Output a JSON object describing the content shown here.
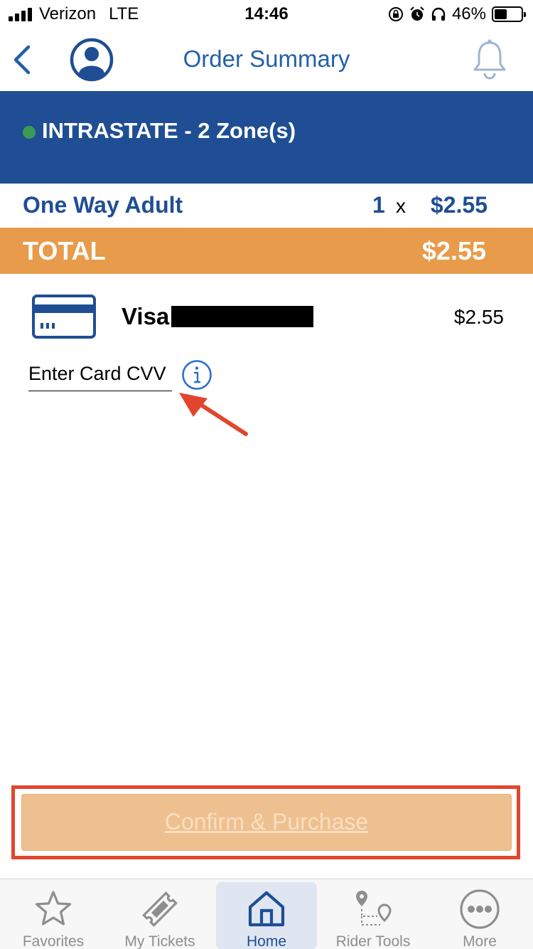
{
  "status_bar": {
    "carrier": "Verizon",
    "network": "LTE",
    "time": "14:46",
    "battery": "46%",
    "battery_level": 0.46
  },
  "nav": {
    "title": "Order Summary",
    "icons": [
      "back-chevron-icon",
      "user-avatar-icon",
      "bell-icon"
    ]
  },
  "colors": {
    "brand_blue": "#1f4e94",
    "link_blue": "#2460a7",
    "total_orange": "#e89b4a",
    "confirm_disabled": "#efc08f",
    "annotation_red": "#e2452f",
    "zone_dot_green": "#3e9a57"
  },
  "zone": {
    "title": "INTRASTATE - 2 Zone(s)"
  },
  "line_item": {
    "name": "One Way Adult",
    "quantity": "1",
    "times": "x",
    "price": "$2.55"
  },
  "total": {
    "label": "TOTAL",
    "value": "$2.55"
  },
  "payment": {
    "brand": "Visa",
    "amount": "$2.55",
    "cvv_placeholder": "Enter Card CVV"
  },
  "confirm": {
    "label": "Confirm & Purchase",
    "disabled": true
  },
  "tabs": [
    {
      "label": "Favorites",
      "icon": "star-icon",
      "active": false
    },
    {
      "label": "My Tickets",
      "icon": "ticket-icon",
      "active": false
    },
    {
      "label": "Home",
      "icon": "home-icon",
      "active": true
    },
    {
      "label": "Rider Tools",
      "icon": "route-pin-icon",
      "active": false
    },
    {
      "label": "More",
      "icon": "more-dots-icon",
      "active": false
    }
  ]
}
